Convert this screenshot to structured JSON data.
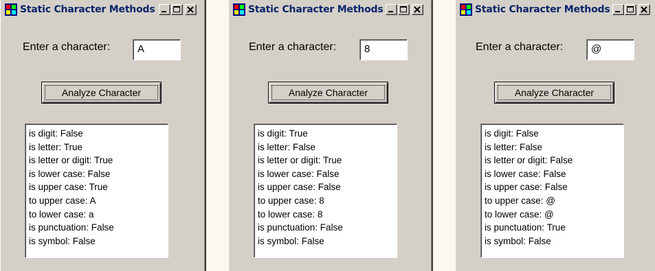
{
  "windows": [
    {
      "title": "Static Character Methods",
      "prompt_label": "Enter a character:",
      "input_value": "A",
      "button_label": "Analyze Character",
      "results": [
        "is digit: False",
        "is letter: True",
        "is letter or digit: True",
        "is lower case: False",
        "is upper case: True",
        "to upper case: A",
        "to lower case: a",
        "is punctuation: False",
        "is symbol: False"
      ]
    },
    {
      "title": "Static Character Methods",
      "prompt_label": "Enter a character:",
      "input_value": "8",
      "button_label": "Analyze Character",
      "results": [
        "is digit: True",
        "is letter: False",
        "is letter or digit: True",
        "is lower case: False",
        "is upper case: False",
        "to upper case: 8",
        "to lower case: 8",
        "is punctuation: False",
        "is symbol: False"
      ]
    },
    {
      "title": "Static Character Methods",
      "prompt_label": "Enter a character:",
      "input_value": "@",
      "button_label": "Analyze Character",
      "results": [
        "is digit: False",
        "is letter: False",
        "is letter or digit: False",
        "is lower case: False",
        "is upper case: False",
        "to upper case: @",
        "to lower case: @",
        "is punctuation: True",
        "is symbol: False"
      ]
    }
  ],
  "icons": {
    "app": "app-window-icon",
    "minimize": "minimize-icon",
    "maximize": "maximize-icon",
    "close": "close-icon"
  },
  "colors": {
    "dialog_face": "#d4d0c8",
    "title_text": "#0a246a",
    "page_background": "#fdf8ee"
  }
}
